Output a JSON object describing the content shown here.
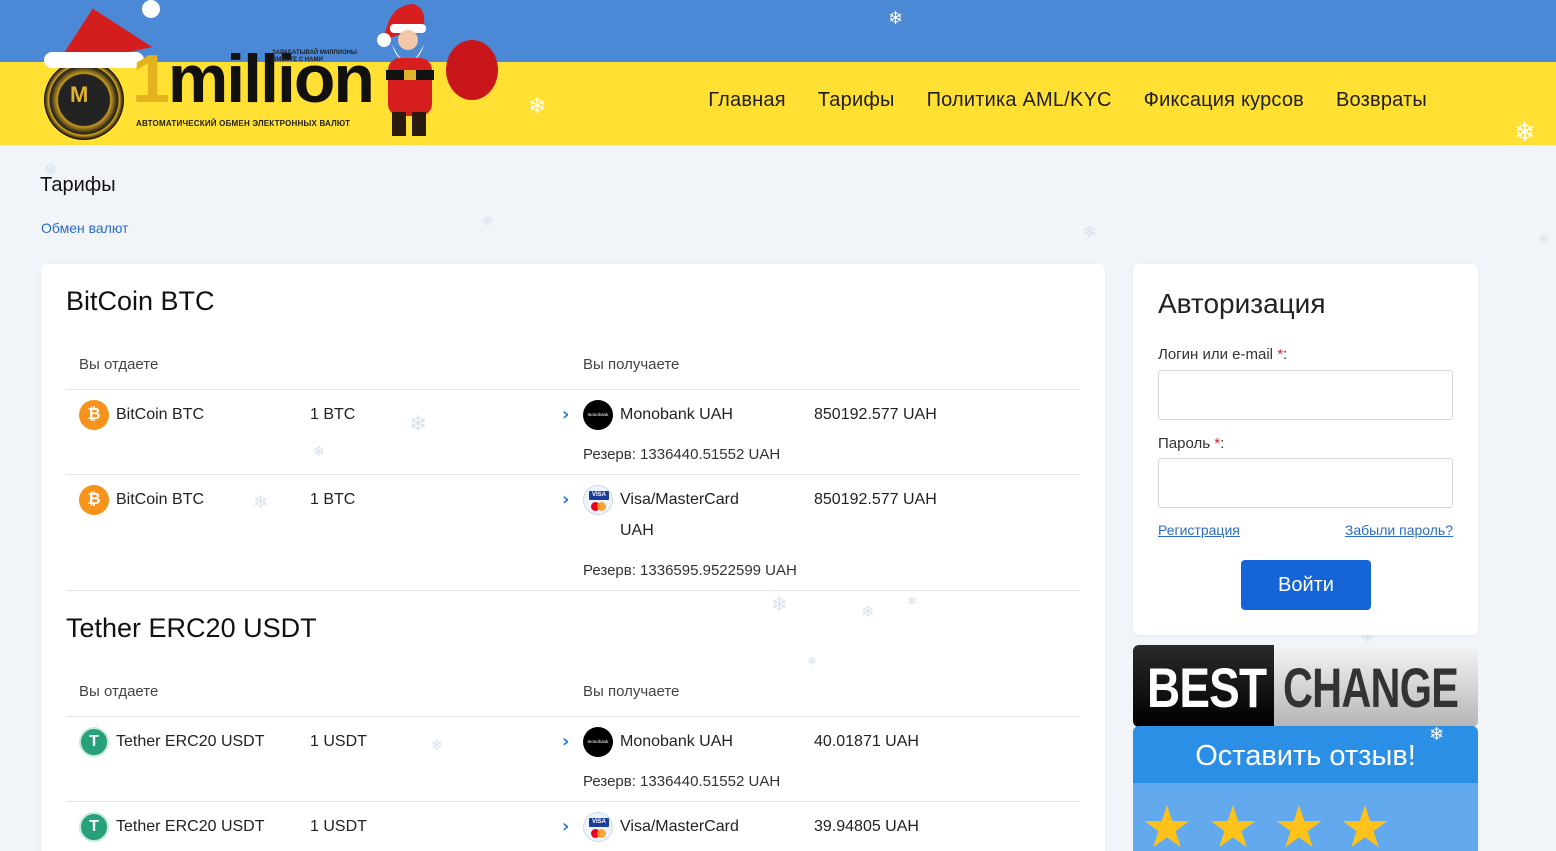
{
  "header": {
    "logo": {
      "word_prefix": "1",
      "word_rest": "million",
      "tag_small": "ЗАРАБАТЫВАЙ МИЛЛИОНЫ ВМЕСТЕ С НАМИ",
      "tagline": "АВТОМАТИЧЕСКИЙ ОБМЕН ЭЛЕКТРОННЫХ ВАЛЮТ",
      "coin_letter": "M"
    },
    "nav": [
      "Главная",
      "Тарифы",
      "Политика AML/KYC",
      "Фиксация курсов",
      "Возвраты"
    ]
  },
  "page": {
    "title": "Тарифы",
    "breadcrumb": "Обмен валют"
  },
  "sections": [
    {
      "title": "BitCoin BTC",
      "col_give": "Вы отдаете",
      "col_get": "Вы получаете",
      "rows": [
        {
          "give_icon": "bitcoin-icon",
          "give_name": "BitCoin BTC",
          "give_amount": "1 BTC",
          "get_icon": "monobank-icon",
          "get_name": "Monobank UAH",
          "get_name2": "",
          "get_amount": "850192.577 UAH",
          "reserve": "Резерв: 1336440.51552 UAH"
        },
        {
          "give_icon": "bitcoin-icon",
          "give_name": "BitCoin BTC",
          "give_amount": "1 BTC",
          "get_icon": "visa-mastercard-icon",
          "get_name": "Visa/MasterCard",
          "get_name2": "UAH",
          "get_amount": "850192.577 UAH",
          "reserve": "Резерв: 1336595.9522599 UAH"
        }
      ]
    },
    {
      "title": "Tether ERC20 USDT",
      "col_give": "Вы отдаете",
      "col_get": "Вы получаете",
      "rows": [
        {
          "give_icon": "tether-icon",
          "give_name": "Tether ERC20 USDT",
          "give_amount": "1 USDT",
          "get_icon": "monobank-icon",
          "get_name": "Monobank UAH",
          "get_name2": "",
          "get_amount": "40.01871 UAH",
          "reserve": "Резерв: 1336440.51552 UAH"
        },
        {
          "give_icon": "tether-icon",
          "give_name": "Tether ERC20 USDT",
          "give_amount": "1 USDT",
          "get_icon": "visa-mastercard-icon",
          "get_name": "Visa/MasterCard",
          "get_name2": "",
          "get_amount": "39.94805 UAH",
          "reserve": ""
        }
      ]
    }
  ],
  "auth": {
    "title": "Авторизация",
    "login_label": "Логин или e-mail",
    "password_label": "Пароль",
    "required_mark": "*",
    "colon": ":",
    "register_link": "Регистрация",
    "forgot_link": "Забыли пароль?",
    "submit": "Войти"
  },
  "bestchange": {
    "best": "BEST",
    "change": "CHANGE",
    "review": "Оставить отзыв!",
    "stars": 4
  },
  "misc": {
    "chevron": "›",
    "snowflake": "❄",
    "star": "★",
    "btc_glyph": "₿",
    "usdt_glyph": "T",
    "mono_text": "monobank",
    "visa_text": "VISA"
  },
  "colors": {
    "header_blue": "#4b88d6",
    "header_yellow": "#ffe033",
    "accent": "#1565d8",
    "link": "#2b6cbf"
  }
}
